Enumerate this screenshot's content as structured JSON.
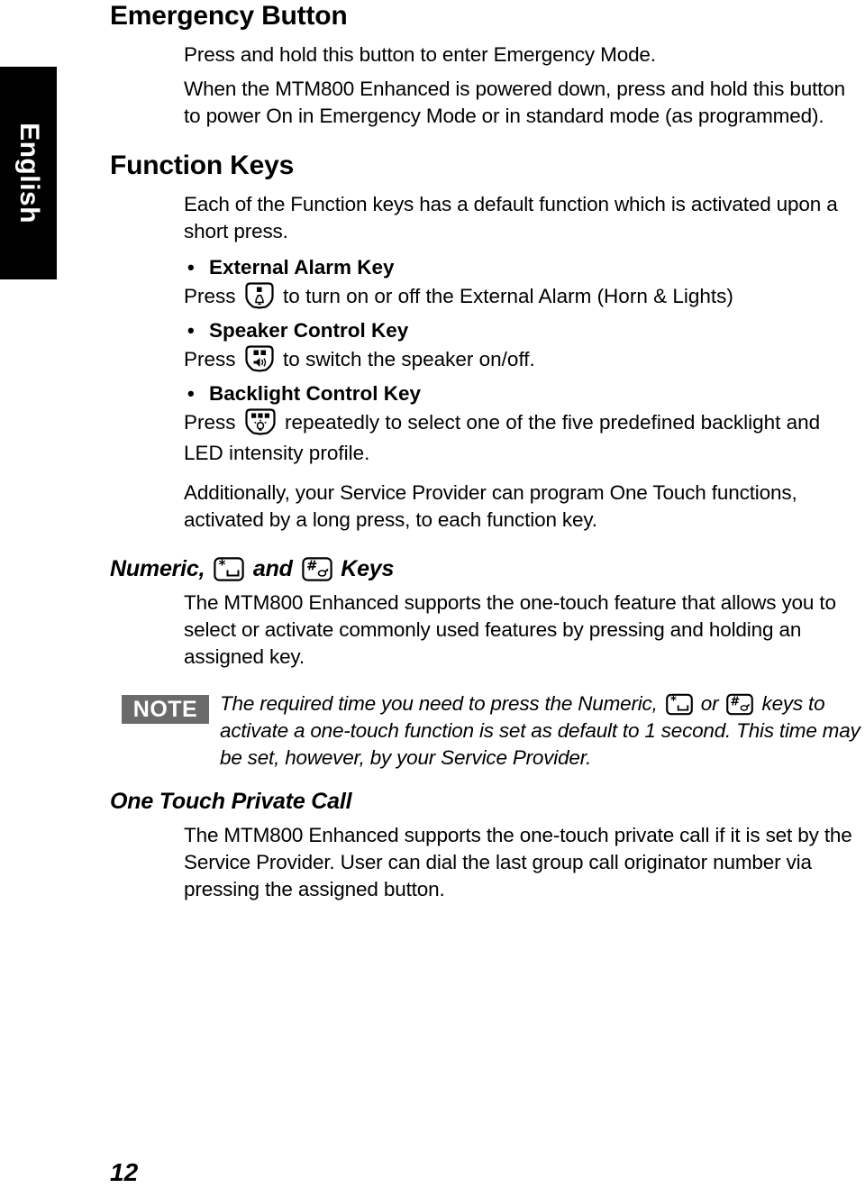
{
  "language_tab": {
    "label": "English"
  },
  "page_number": "12",
  "sections": {
    "emergency_button": {
      "title": "Emergency Button",
      "paragraph_1": "Press and hold this button to enter Emergency Mode.",
      "paragraph_2": "When the MTM800 Enhanced is powered down, press and hold this button to power On in Emergency Mode or in standard mode (as programmed)."
    },
    "function_keys": {
      "title": "Function Keys",
      "intro": "Each of the Function keys has a default function which is activated upon a short press.",
      "items": [
        {
          "bullet_label": "External Alarm Key",
          "press_word": "Press",
          "icon": "external-alarm-key-icon",
          "description": "to turn on or off the External Alarm (Horn & Lights)"
        },
        {
          "bullet_label": "Speaker Control Key",
          "press_word": "Press",
          "icon": "speaker-control-key-icon",
          "description": "to switch the speaker on/off."
        },
        {
          "bullet_label": "Backlight Control Key",
          "press_word": "Press",
          "icon": "backlight-control-key-icon",
          "description": "repeatedly to select one of the five predefined backlight and LED intensity profile."
        }
      ],
      "closing": "Additionally, your Service Provider can program One Touch functions, activated by a long press, to each function key."
    },
    "numeric_keys": {
      "title_part_1": "Numeric,",
      "title_part_2": "and",
      "title_part_3": "Keys",
      "star_icon": "star-key-icon",
      "hash_icon": "hash-key-icon",
      "paragraph": "The MTM800 Enhanced supports the one-touch feature that allows you to select or activate commonly used features by pressing and holding an assigned key."
    },
    "note": {
      "badge": "NOTE",
      "text_part_1": "The required time you need to press the Numeric,",
      "text_part_2": "or",
      "text_part_3": "keys to activate a one-touch function is set as default to 1 second. This time may be set, however, by your Service Provider.",
      "star_icon": "star-key-icon",
      "hash_icon": "hash-key-icon",
      "badge_bg": "#6b6b6b",
      "badge_fg": "#ffffff"
    },
    "one_touch_private_call": {
      "title": "One Touch Private Call",
      "paragraph": "The MTM800 Enhanced supports the one-touch private call if it is set by the Service Provider. User can dial the last group call originator number via pressing the assigned button."
    }
  },
  "colors": {
    "page_background": "#ffffff",
    "text": "#000000",
    "tab_background": "#000000",
    "tab_text": "#ffffff"
  }
}
